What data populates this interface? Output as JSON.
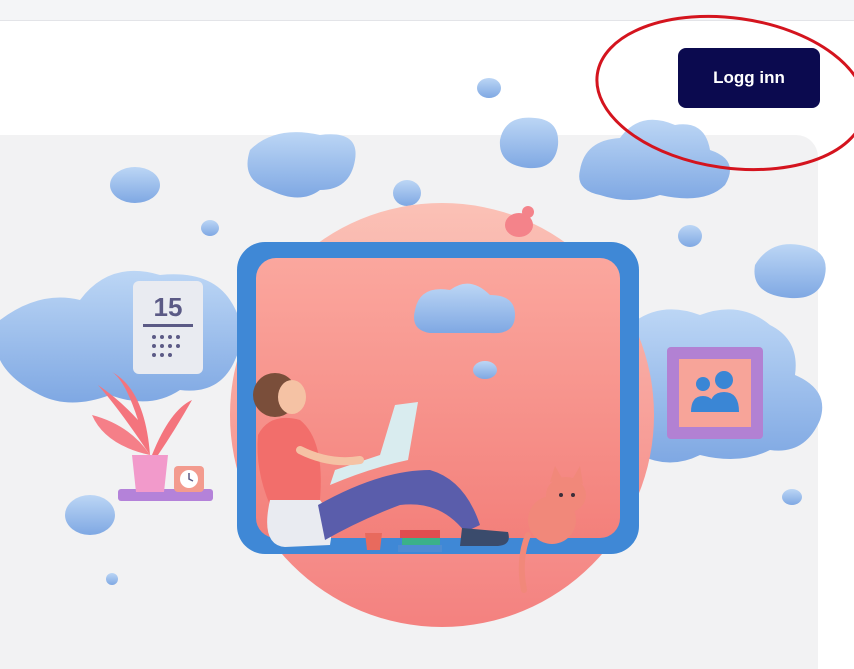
{
  "header": {
    "login_label": "Logg inn"
  },
  "illustration": {
    "calendar_day": "15",
    "scene": "woman-with-laptop-in-window-frame"
  },
  "colors": {
    "login_button": "#0b0a4f",
    "annotation_circle": "#d4141e",
    "cloud": "#9cc0ec",
    "sun_circle": "#f6a19a",
    "frame": "#3f88d6"
  }
}
